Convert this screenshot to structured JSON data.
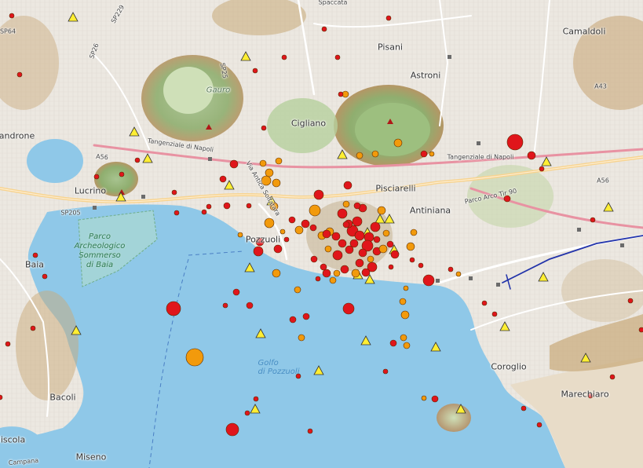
{
  "map": {
    "water_color": "#8fc8e8",
    "land_color": "#f2efe9",
    "place_labels": [
      {
        "id": "spaccata",
        "text": "Spaccata",
        "cls": "small"
      },
      {
        "id": "pisani",
        "text": "Pisani",
        "cls": ""
      },
      {
        "id": "camaldoli",
        "text": "Camaldoli",
        "cls": ""
      },
      {
        "id": "astroni",
        "text": "Astroni",
        "cls": ""
      },
      {
        "id": "gauro",
        "text": "Gauro",
        "cls": "volc"
      },
      {
        "id": "cigliano",
        "text": "Cigliano",
        "cls": ""
      },
      {
        "id": "landrone",
        "text": "landrone",
        "cls": ""
      },
      {
        "id": "tangenziale-w",
        "text": "Tangenziale di Napoli",
        "cls": "small"
      },
      {
        "id": "tangenziale-e",
        "text": "Tangenziale di Napoli",
        "cls": "small"
      },
      {
        "id": "lucrino",
        "text": "Lucrino",
        "cls": ""
      },
      {
        "id": "pisciarelli",
        "text": "Pisciarelli",
        "cls": ""
      },
      {
        "id": "antiniana",
        "text": "Antiniana",
        "cls": ""
      },
      {
        "id": "pozzuoli",
        "text": "Pozzuoli",
        "cls": ""
      },
      {
        "id": "baia",
        "text": "Baia",
        "cls": ""
      },
      {
        "id": "golfo",
        "text": "Golfo\ndi Pozzuoli",
        "cls": "water"
      },
      {
        "id": "coroglio",
        "text": "Coroglio",
        "cls": ""
      },
      {
        "id": "marechiaro",
        "text": "Marechiaro",
        "cls": ""
      },
      {
        "id": "bacoli",
        "text": "Bacoli",
        "cls": ""
      },
      {
        "id": "miseno",
        "text": "Miseno",
        "cls": ""
      },
      {
        "id": "liscola",
        "text": "liscola",
        "cls": ""
      },
      {
        "id": "parco",
        "text": "Parco\nArcheologico\nSommerso\ndi Baia",
        "cls": "park"
      },
      {
        "id": "sp205",
        "text": "SP205",
        "cls": "small"
      },
      {
        "id": "a56",
        "text": "A56",
        "cls": "small"
      },
      {
        "id": "a56b",
        "text": "A56",
        "cls": "small"
      },
      {
        "id": "sp229",
        "text": "SP229",
        "cls": "small"
      },
      {
        "id": "sp26",
        "text": "SP26",
        "cls": "small"
      },
      {
        "id": "sp25",
        "text": "SP25",
        "cls": "small"
      },
      {
        "id": "via-solfatara",
        "text": "Via Antica Solfatara",
        "cls": "small"
      },
      {
        "id": "parco-arco",
        "text": "Parco Arco Tir 90",
        "cls": "small"
      },
      {
        "id": "a43",
        "text": "A43",
        "cls": "small"
      },
      {
        "id": "campana",
        "text": "Campana",
        "cls": "small"
      },
      {
        "id": "sp64",
        "text": "SP64",
        "cls": "small"
      }
    ],
    "stations_color": "#ffee33",
    "red_color": "#e0151b",
    "orange_color": "#f29a0c"
  }
}
